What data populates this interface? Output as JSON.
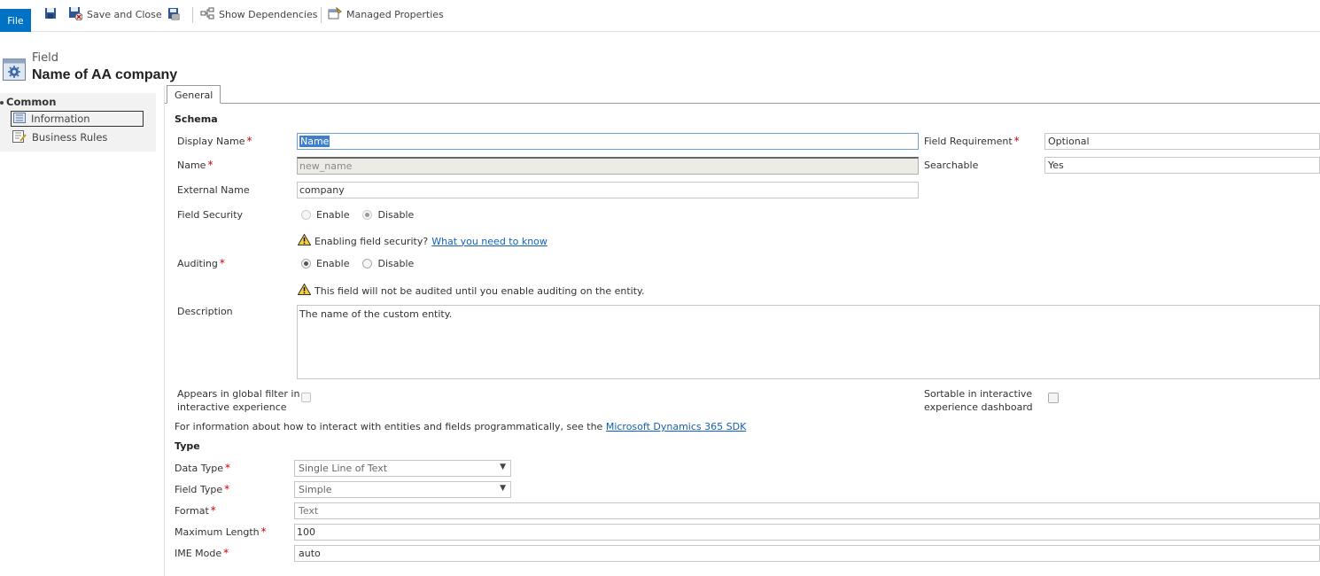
{
  "toolbar": {
    "file_label": "File",
    "save_icon": "save-icon",
    "save_close_label": "Save and Close",
    "publish_icon": "publish-icon",
    "show_dependencies_label": "Show Dependencies",
    "managed_properties_label": "Managed Properties"
  },
  "header": {
    "entity_type": "Field",
    "title": "Name of AA company"
  },
  "nav": {
    "group_label": "Common",
    "items": [
      {
        "label": "Information",
        "icon": "information-icon",
        "selected": true
      },
      {
        "label": "Business Rules",
        "icon": "business-rules-icon",
        "selected": false
      }
    ]
  },
  "tabs": [
    {
      "label": "General",
      "active": true
    }
  ],
  "schema": {
    "section_title": "Schema",
    "display_name_label": "Display Name",
    "display_name_value": "Name",
    "name_label": "Name",
    "name_value": "new_name",
    "external_name_label": "External Name",
    "external_name_value": "company",
    "field_security_label": "Field Security",
    "field_security_options": [
      "Enable",
      "Disable"
    ],
    "field_security_selected": "Disable",
    "security_warning_text": "Enabling field security?",
    "security_warning_link": "What you need to know",
    "auditing_label": "Auditing",
    "auditing_options": [
      "Enable",
      "Disable"
    ],
    "auditing_selected": "Enable",
    "auditing_warning_text": "This field will not be audited until you enable auditing on the entity.",
    "description_label": "Description",
    "description_value": "The name of the custom entity.",
    "field_requirement_label": "Field Requirement",
    "field_requirement_value": "Optional",
    "searchable_label": "Searchable",
    "searchable_value": "Yes",
    "global_filter_label_1": "Appears in global filter in",
    "global_filter_label_2": "interactive experience",
    "sortable_label_1": "Sortable in interactive",
    "sortable_label_2": "experience dashboard",
    "sdk_text": "For information about how to interact with entities and fields programmatically, see the",
    "sdk_link": "Microsoft Dynamics 365 SDK"
  },
  "type": {
    "section_title": "Type",
    "data_type_label": "Data Type",
    "data_type_value": "Single Line of Text",
    "field_type_label": "Field Type",
    "field_type_value": "Simple",
    "format_label": "Format",
    "format_value": "Text",
    "max_length_label": "Maximum Length",
    "max_length_value": "100",
    "ime_mode_label": "IME Mode",
    "ime_mode_value": "auto"
  },
  "colors": {
    "file_button": "#0072c6",
    "required_asterisk": "#cc0000",
    "link": "#1160b7",
    "focus_border": "#6a9fd8"
  }
}
